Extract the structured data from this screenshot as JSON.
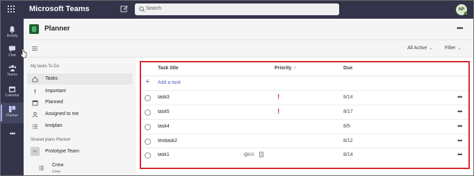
{
  "app": {
    "brand": "Microsoft Teams",
    "search_placeholder": "Search",
    "avatar_initials": "NP"
  },
  "rail": [
    {
      "label": "Activity",
      "icon": "bell-icon"
    },
    {
      "label": "Chat",
      "icon": "chat-icon"
    },
    {
      "label": "Teams",
      "icon": "teams-icon"
    },
    {
      "label": "Calendar",
      "icon": "calendar-icon"
    },
    {
      "label": "Planner",
      "icon": "planner-icon",
      "active": true
    }
  ],
  "header": {
    "title": "Planner",
    "more": "•••"
  },
  "toolbar": {
    "all_active": "All Active",
    "filter": "Filter",
    "chevron": "⌄"
  },
  "leftnav": {
    "my_tasks_header": "My tasks  To Do",
    "items": [
      {
        "label": "Tasks",
        "icon": "home-icon",
        "selected": true
      },
      {
        "label": "Important",
        "icon": "exclamation-icon"
      },
      {
        "label": "Planned",
        "icon": "calendar-icon"
      },
      {
        "label": "Assigned to me",
        "icon": "person-icon"
      },
      {
        "label": "testplan",
        "icon": "list-icon"
      }
    ],
    "shared_header": "Shared plans  Planner",
    "shared": [
      {
        "label": "Prototype Team",
        "badge": "PT"
      },
      {
        "label": "Crew",
        "sub": "Crew"
      }
    ]
  },
  "tasks": {
    "columns": {
      "title": "Task title",
      "priority": "Priority",
      "due": "Due"
    },
    "sort_glyph": "↑",
    "add_label": "Add a task",
    "add_glyph": "+",
    "more_glyph": "•••",
    "priority_glyph": "!",
    "rows": [
      {
        "title": "task3",
        "priority": "!",
        "due": "8/14"
      },
      {
        "title": "task5",
        "priority": "!",
        "due": "8/17"
      },
      {
        "title": "task4",
        "priority": "",
        "due": "8/5"
      },
      {
        "title": "testtask2",
        "priority": "",
        "due": "8/12"
      },
      {
        "title": "task1",
        "priority": "",
        "due": "8/14",
        "checklist": "0/3",
        "has_note": true
      }
    ]
  },
  "colors": {
    "rail_bg": "#33344a",
    "accent": "#5b5fc7",
    "highlight_border": "#d9262c",
    "priority": "#c4314b"
  }
}
